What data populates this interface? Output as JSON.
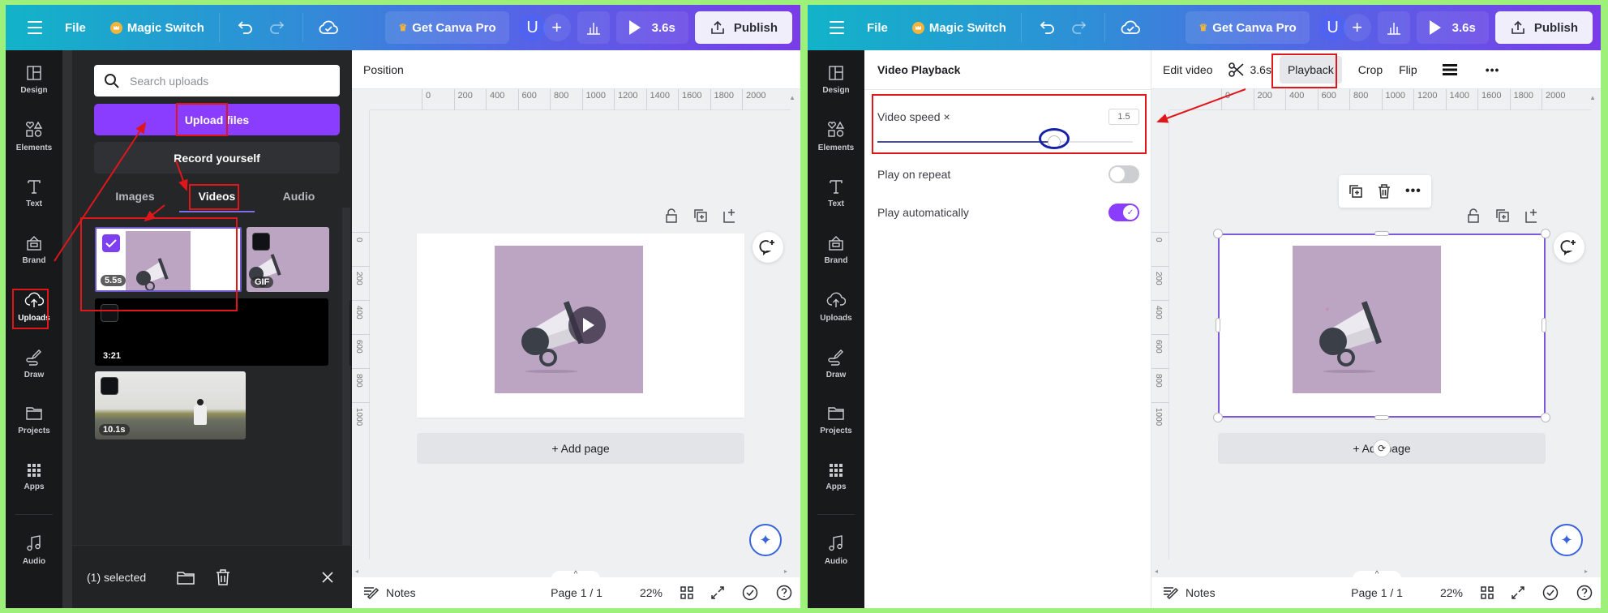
{
  "topbar": {
    "file_label": "File",
    "magic_switch_label": "Magic Switch",
    "get_pro_label": "Get Canva Pro",
    "avatar_initial": "U",
    "add_label": "+",
    "play_duration": "3.6s",
    "publish_label": "Publish"
  },
  "nav": {
    "items": [
      {
        "label": "Design",
        "icon": "layout-icon"
      },
      {
        "label": "Elements",
        "icon": "shapes-icon"
      },
      {
        "label": "Text",
        "icon": "text-icon"
      },
      {
        "label": "Brand",
        "icon": "brand-kit-icon"
      },
      {
        "label": "Uploads",
        "icon": "cloud-upload-icon"
      },
      {
        "label": "Draw",
        "icon": "pen-icon"
      },
      {
        "label": "Projects",
        "icon": "folder-icon"
      },
      {
        "label": "Apps",
        "icon": "grid-icon"
      },
      {
        "label": "Audio",
        "icon": "music-note-icon"
      }
    ]
  },
  "uploads": {
    "search_placeholder": "Search uploads",
    "upload_button": "Upload files",
    "record_button": "Record yourself",
    "tabs": [
      {
        "label": "Images",
        "active": false
      },
      {
        "label": "Videos",
        "active": true
      },
      {
        "label": "Audio",
        "active": false
      }
    ],
    "items": [
      {
        "duration": "5.5s",
        "selected": true,
        "kind": "megaphone-video"
      },
      {
        "duration": "GIF",
        "selected": false,
        "kind": "megaphone-gif"
      },
      {
        "duration": "3:21",
        "selected": false,
        "kind": "black-video"
      },
      {
        "duration": "10.1s",
        "selected": false,
        "kind": "landscape-video"
      }
    ],
    "selection_text": "(1) selected"
  },
  "left_canvas": {
    "context_label": "Position"
  },
  "ruler": {
    "h_ticks": [
      "0",
      "200",
      "400",
      "600",
      "800",
      "1000",
      "1200",
      "1400",
      "1600",
      "1800",
      "2000"
    ],
    "v_ticks": [
      "0",
      "200",
      "400",
      "600",
      "800",
      "1000"
    ]
  },
  "canvas": {
    "add_page_label": "+ Add page"
  },
  "footer": {
    "notes_label": "Notes",
    "page_label": "Page 1 / 1",
    "zoom_label": "22%"
  },
  "playback_panel": {
    "title": "Video Playback",
    "speed_label": "Video speed ×",
    "speed_value": "1.5",
    "speed_fraction": 0.69,
    "repeat_label": "Play on repeat",
    "repeat_on": false,
    "autoplay_label": "Play automatically",
    "autoplay_on": true
  },
  "edit_bar": {
    "edit_video_label": "Edit video",
    "trim_duration": "3.6s",
    "playback_label": "Playback",
    "crop_label": "Crop",
    "flip_label": "Flip"
  },
  "colors": {
    "accent": "#8b3dff",
    "annotation_red": "#e0161b",
    "annotation_blue": "#1522a8",
    "selection_frame": "#7d5ad9",
    "thumbnail_purple": "#bba5c3"
  }
}
